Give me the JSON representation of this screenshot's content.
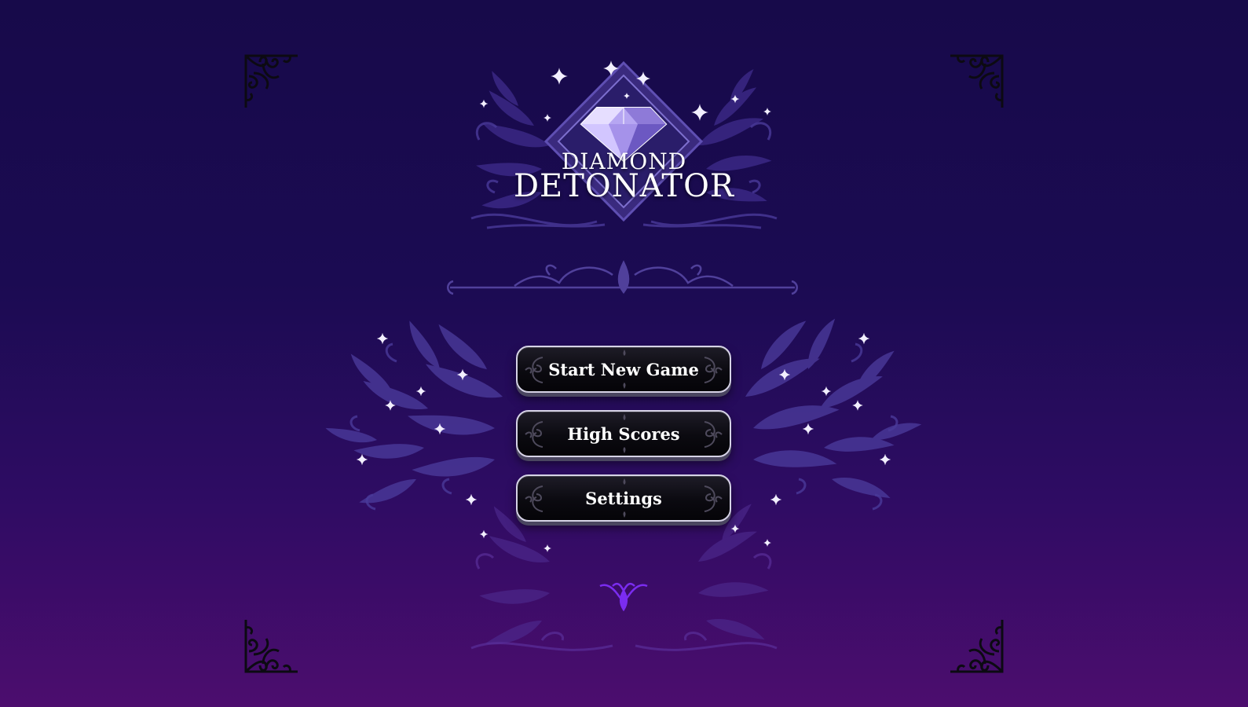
{
  "game": {
    "title_line1": "DIAMOND",
    "title_line2": "DETONATOR"
  },
  "menu": {
    "start_label": "Start New Game",
    "scores_label": "High Scores",
    "settings_label": "Settings"
  },
  "icons": {
    "logo": "diamond-gem-icon",
    "sparkle": "sparkle-icon",
    "corner": "filigree-corner-icon",
    "bottom": "fleur-ornament-icon"
  },
  "colors": {
    "bg_top": "#170a4a",
    "bg_bottom": "#4c0d6e",
    "ornament": "#4a3a9a",
    "button_bg": "#0b0a10",
    "button_border": "#d6d3e6",
    "text": "#ffffff",
    "accent": "#7b2cf0"
  }
}
